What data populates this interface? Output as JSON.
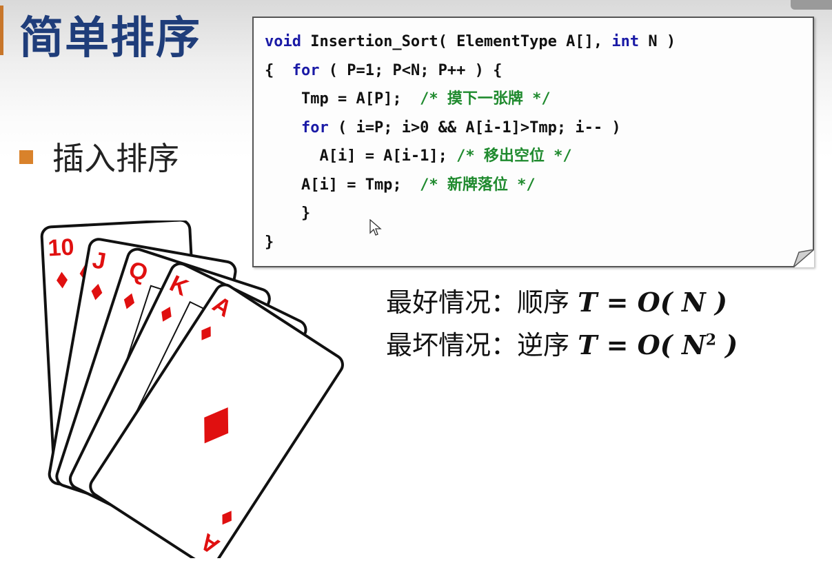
{
  "title": "简单排序",
  "bullet": "插入排序",
  "code": {
    "line1": {
      "kw_void": "void",
      "t1": " Insertion_Sort( ElementType A[], ",
      "kw_int": "int",
      "t2": " N )"
    },
    "line2": {
      "t1": "{  ",
      "kw_for": "for",
      "t2": " ( P=1; P<N; P++ ) {"
    },
    "line3": {
      "t1": "    Tmp = A[P];  ",
      "c": "/* 摸下一张牌 */"
    },
    "line4": {
      "t1": "    ",
      "kw_for": "for",
      "t2": " ( i=P; i>0 && A[i-1]>Tmp; i-- )"
    },
    "line5": {
      "t1": "      A[i] = A[i-1]; ",
      "c": "/* 移出空位 */"
    },
    "line6": {
      "t1": "    A[i] = Tmp;  ",
      "c": "/* 新牌落位 */"
    },
    "line7": "    }",
    "line8": "}"
  },
  "complexity": {
    "best_label": "最好情况：顺序 ",
    "best_math": "T = O( N )",
    "worst_label": "最坏情况：逆序 ",
    "worst_math_pre": "T = O( N",
    "worst_exp": "2",
    "worst_math_post": " )"
  },
  "cards": {
    "ranks": [
      "10",
      "J",
      "Q",
      "K",
      "A"
    ],
    "suit": "diamond-icon",
    "suit_color": "#e01010"
  },
  "colors": {
    "title": "#1f3d7a",
    "bullet": "#d9822b",
    "keyword": "#1a1aa6",
    "comment": "#1f8a2e"
  }
}
